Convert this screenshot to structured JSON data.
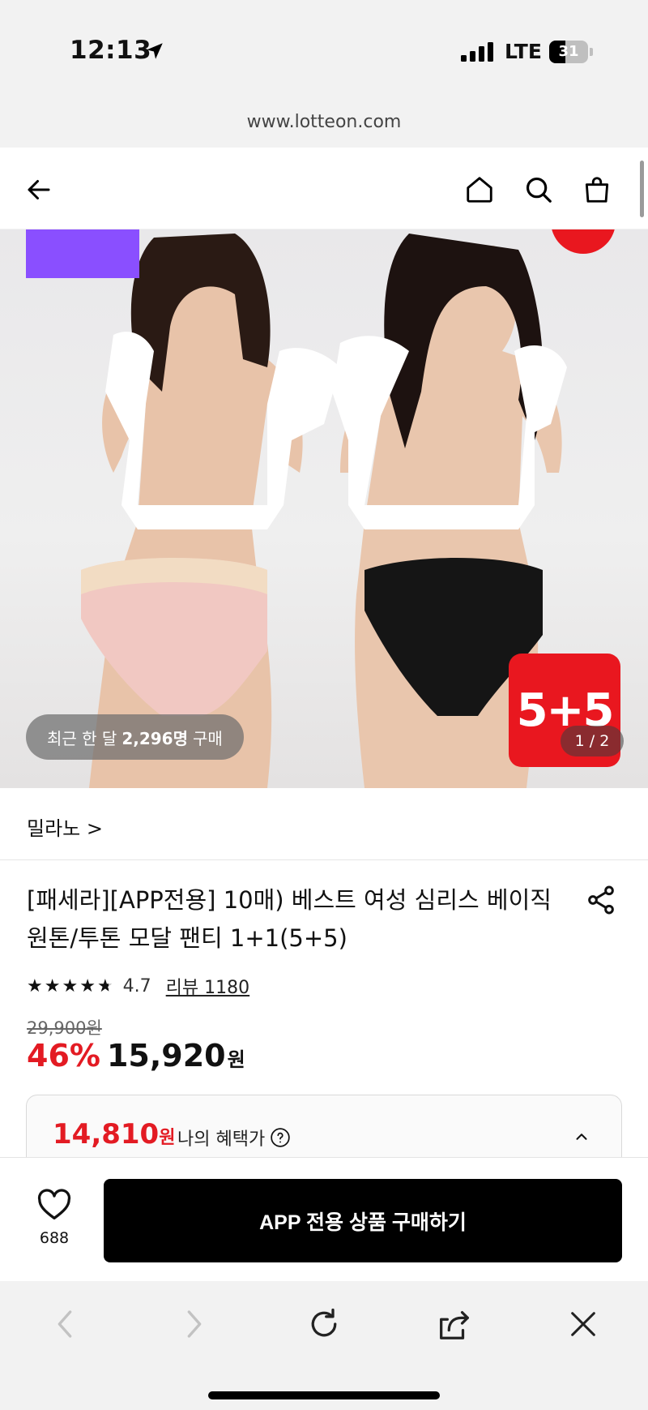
{
  "status_bar": {
    "time": "12:13",
    "network": "LTE",
    "battery": "31"
  },
  "browser": {
    "url": "www.lotteon.com"
  },
  "hero": {
    "promo_badge": "5+5",
    "recent_purchase": {
      "prefix": "최근 한 달",
      "count": "2,296명",
      "suffix": "구매"
    },
    "page_counter": "1 / 2"
  },
  "product": {
    "brand": "밀라노 >",
    "title": "[패세라][APP전용] 10매) 베스트 여성 심리스 베이직 원톤/투톤 모달 팬티 1+1(5+5)",
    "rating": {
      "stars": 4.7,
      "value": "4.7",
      "review_label": "리뷰 1180"
    },
    "original_price": "29,900원",
    "discount_rate": "46%",
    "price": "15,920",
    "currency": "원",
    "benefit": {
      "price": "14,810",
      "currency": "원",
      "label": "나의 혜택가"
    }
  },
  "bottom_bar": {
    "wish_count": "688",
    "buy_label": "APP 전용 상품 구매하기"
  },
  "colors": {
    "accent_red": "#e31b23",
    "badge_purple": "#8a4fff",
    "button_black": "#000000"
  }
}
